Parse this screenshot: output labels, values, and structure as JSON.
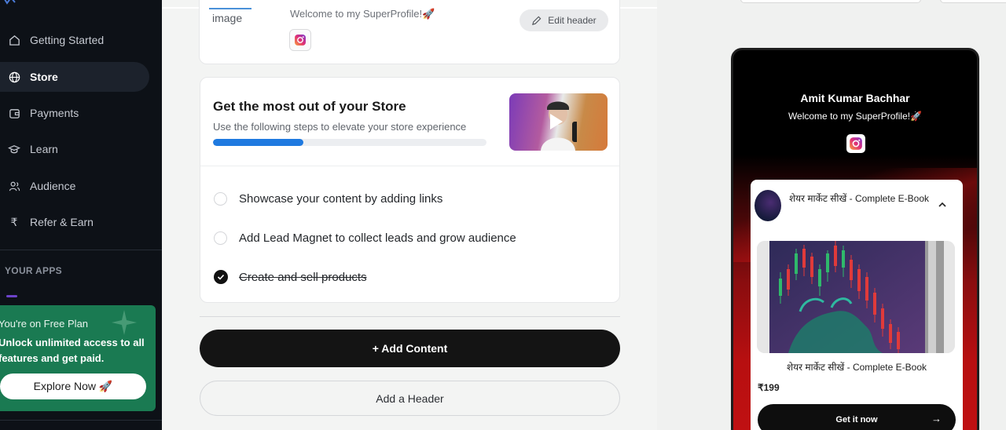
{
  "sidebar": {
    "nav": [
      {
        "label": "Getting Started",
        "icon": "home-icon"
      },
      {
        "label": "Store",
        "icon": "globe-icon",
        "active": true
      },
      {
        "label": "Payments",
        "icon": "wallet-icon"
      },
      {
        "label": "Learn",
        "icon": "graduation-cap-icon"
      },
      {
        "label": "Audience",
        "icon": "users-icon"
      },
      {
        "label": "Refer & Earn",
        "icon": "rupee-icon"
      }
    ],
    "apps_label": "YOUR APPS",
    "plan": {
      "line1": "You're on Free Plan",
      "line2": "Unlock unlimited access to all features and get paid.",
      "cta": "Explore Now 🚀"
    }
  },
  "header_card": {
    "tab_label": "image",
    "welcome": "Welcome to my SuperProfile!🚀",
    "edit_label": "Edit header"
  },
  "store_card": {
    "title": "Get the most out of your Store",
    "subtitle": "Use the following steps to elevate your store experience",
    "progress_fraction": 0.33,
    "steps": [
      {
        "label": "Showcase your content by adding links",
        "done": false
      },
      {
        "label": "Add Lead Magnet to collect leads and grow audience",
        "done": false
      },
      {
        "label": "Create and sell products",
        "done": true
      }
    ]
  },
  "actions": {
    "add_content": "+ Add Content",
    "add_header": "Add a Header"
  },
  "preview": {
    "name": "Amit Kumar Bachhar",
    "welcome": "Welcome to my SuperProfile!🚀",
    "product": {
      "title": "शेयर मार्केट सीखें - Complete E-Book",
      "caption": "शेयर मार्केट सीखें - Complete E-Book",
      "price": "₹199",
      "cta": "Get it now"
    }
  },
  "colors": {
    "accent": "#1f7ae0",
    "sidebar_bg": "#0d1117",
    "plan_green": "#1a7a52"
  }
}
